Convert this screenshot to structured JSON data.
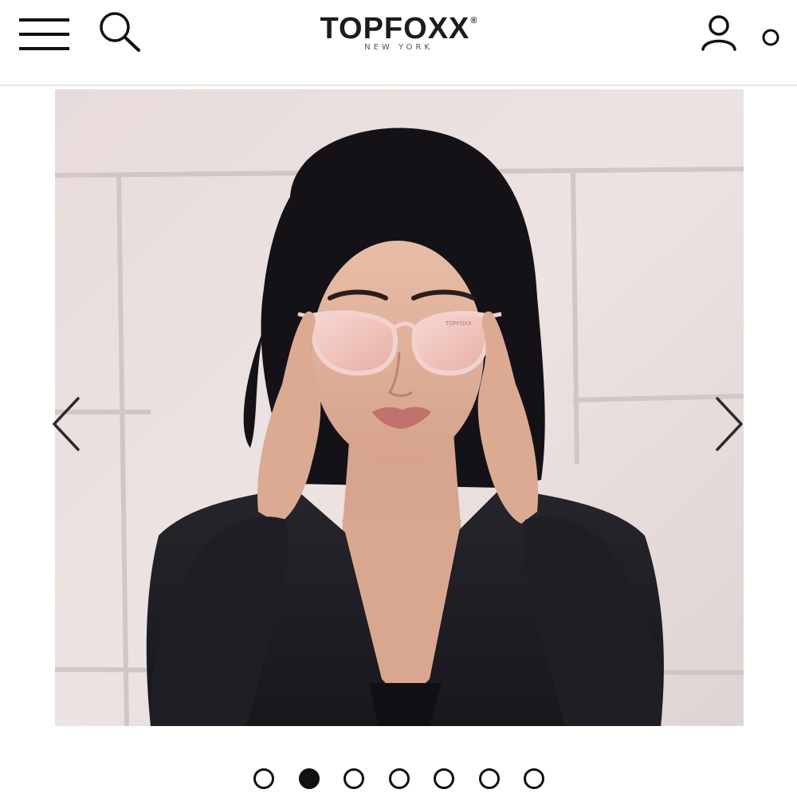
{
  "header": {
    "logo_main": "TOPFOXX",
    "logo_reg": "®",
    "logo_sub": "NEW YORK",
    "icons": {
      "menu": "hamburger-menu-icon",
      "search": "search-icon",
      "account": "account-icon",
      "cart": "cart-icon"
    }
  },
  "gallery": {
    "image_description": "Model with black hair wearing rose gold cat-eye sunglasses and a black blazer against a light stone wall",
    "sunglasses_brand_mark": "TOPFOXX",
    "slide_count": 7,
    "active_slide": 2,
    "icons": {
      "prev": "chevron-left-icon",
      "next": "chevron-right-icon"
    }
  },
  "colors": {
    "text": "#1c1c1c",
    "wall": "#e8dfdf",
    "lens": "#f2c6c0",
    "frame": "#f0d2cf",
    "blazer": "#1d1c22",
    "hair": "#141217"
  }
}
